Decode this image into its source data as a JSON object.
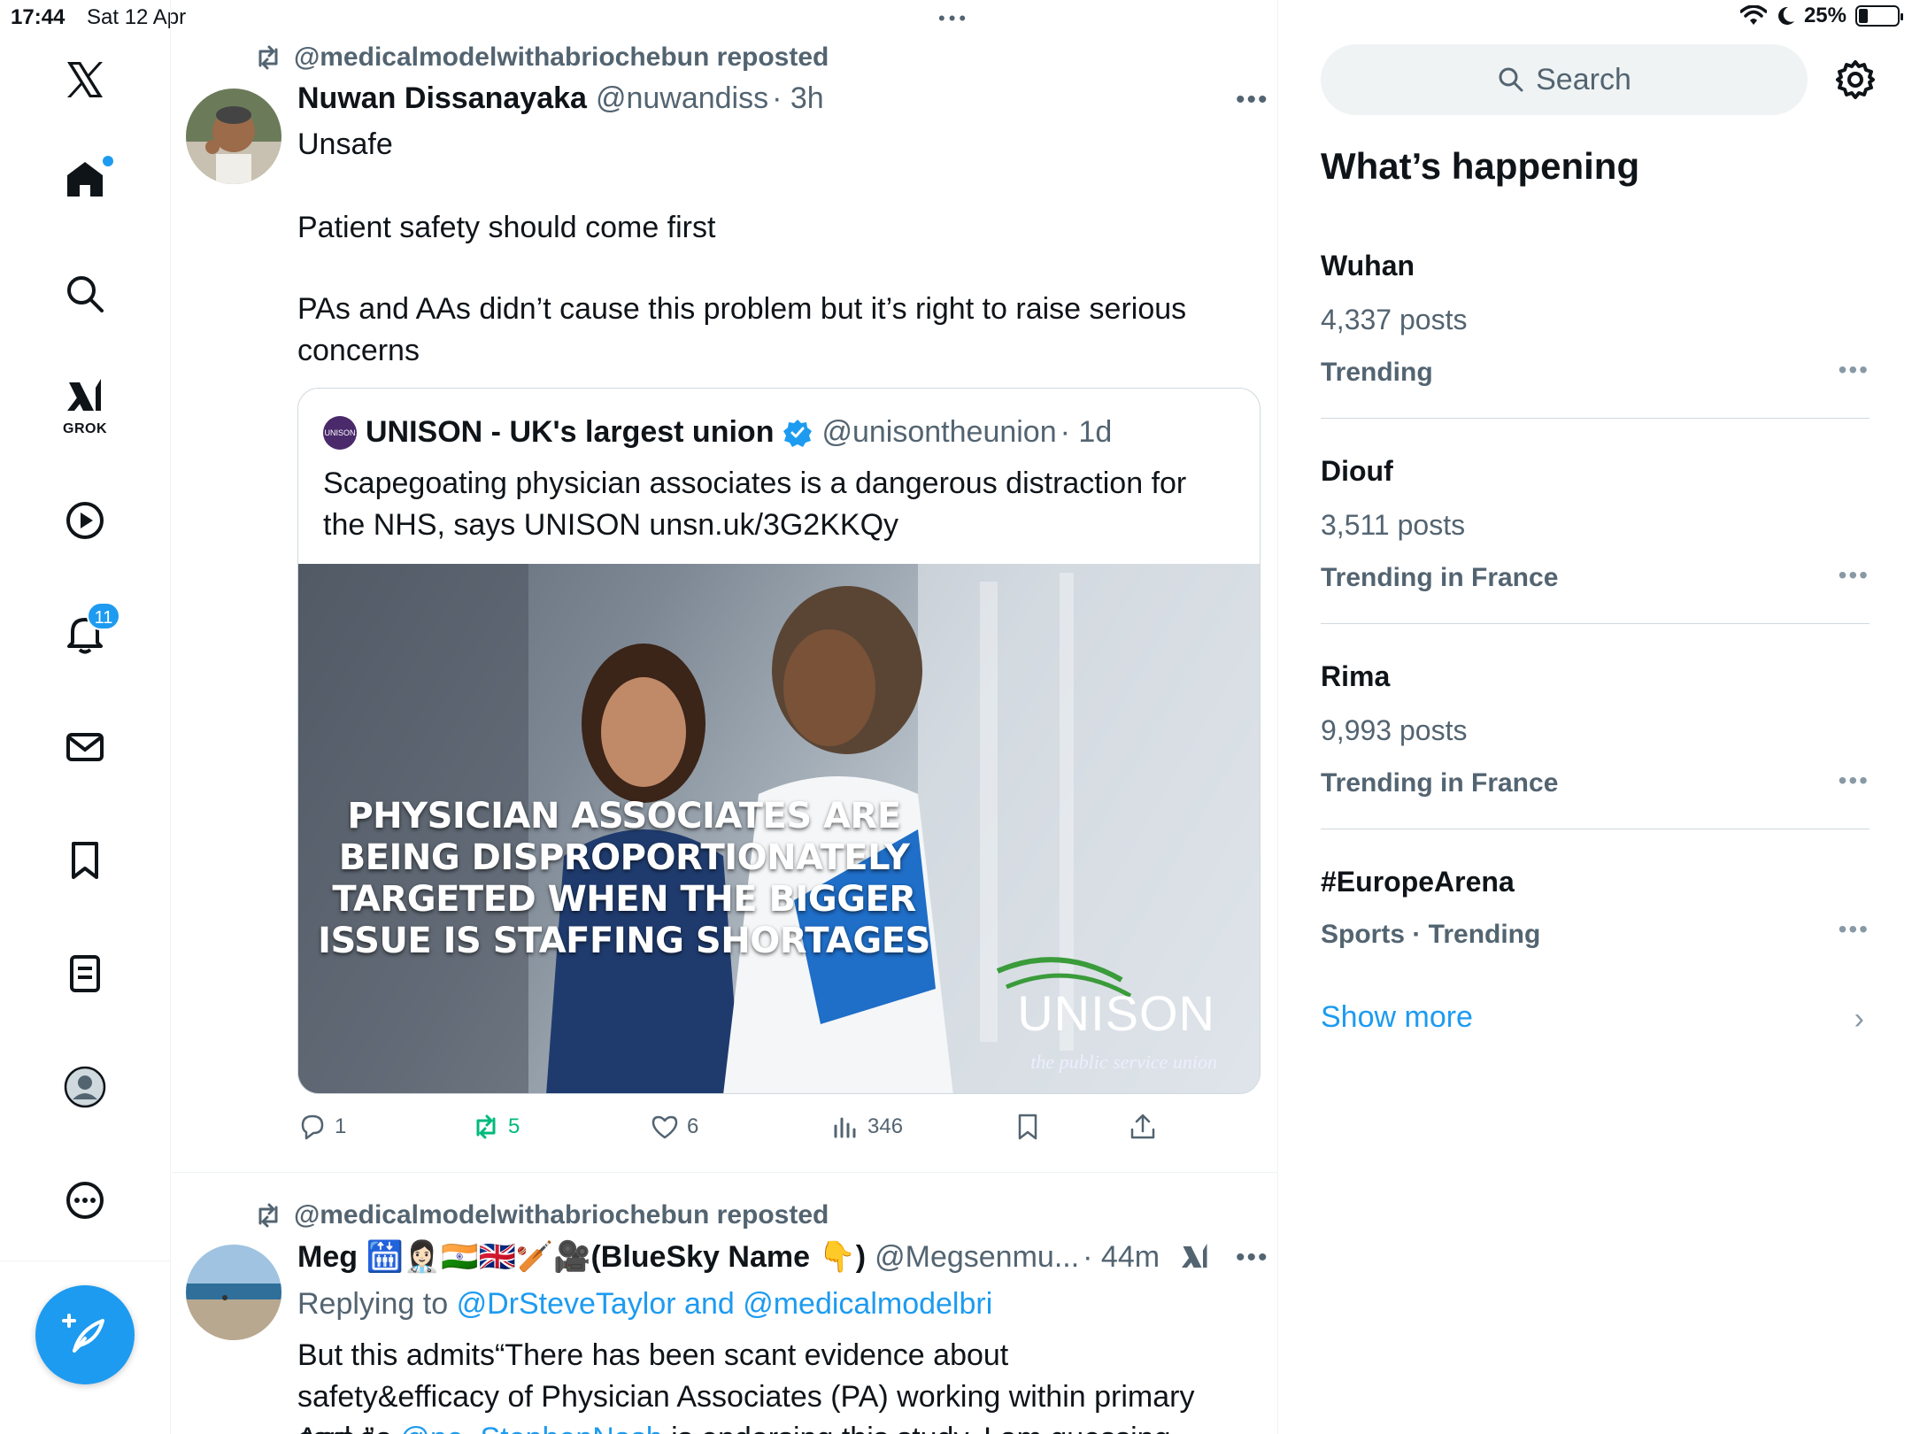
{
  "status_bar": {
    "time": "17:44",
    "date": "Sat 12 Apr",
    "battery": "25%"
  },
  "nav": {
    "grok_label": "GROK",
    "notifications_count": "11"
  },
  "tweet1": {
    "repost_by": "@medicalmodelwithabriochebun reposted",
    "name": "Nuwan Dissanayaka",
    "handle": "@nuwandiss",
    "time": "· 3h",
    "text1": "Unsafe",
    "text2": "Patient safety should come first",
    "text3": "PAs and AAs didn’t cause this problem but it’s right to raise serious concerns",
    "quote": {
      "name": "UNISON - UK's largest union",
      "handle": "@unisontheunion",
      "time": "· 1d",
      "text": "Scapegoating physician associates is a dangerous distraction for the NHS, says UNISON unsn.uk/3G2KKQy",
      "image_headline": "PHYSICIAN ASSOCIATES ARE BEING DISPROPORTIONATELY TARGETED WHEN THE BIGGER ISSUE IS STAFFING SHORTAGES",
      "logo_text": "UNISON",
      "logo_tagline": "the public service union",
      "avatar_text": "UNISON"
    },
    "actions": {
      "replies": "1",
      "reposts": "5",
      "likes": "6",
      "views": "346"
    }
  },
  "tweet2": {
    "repost_by": "@medicalmodelwithabriochebun reposted",
    "name": "Meg 🛗👩🏻‍⚕️🇮🇳🇬🇧🏏🎥(BlueSky Name 👇)",
    "handle": "@Megsenmu...",
    "time": "· 44m",
    "replying_prefix": "Replying to",
    "replying_to": "@DrSteveTaylor and @medicalmodelbri",
    "text1": "But this admits“There has been scant evidence about safety&efficacy of Physician Associates (PA) working within primary care.”",
    "text2_prefix": "And as",
    "text2_link": "@ne_StephenNash",
    "text2_rest": "is endorsing this study, I am guessing he"
  },
  "sidebar": {
    "search_placeholder": "Search",
    "title": "What’s happening",
    "trends": [
      {
        "name": "Wuhan",
        "posts": "4,337 posts",
        "meta": "Trending"
      },
      {
        "name": "Diouf",
        "posts": "3,511 posts",
        "meta": "Trending in France"
      },
      {
        "name": "Rima",
        "posts": "9,993 posts",
        "meta": "Trending in France"
      },
      {
        "name": "#EuropeArena",
        "meta": "Sports · Trending"
      }
    ],
    "show_more": "Show more"
  },
  "colors": {
    "accent": "#1d9bf0",
    "repost_green": "#00ba7c",
    "muted": "#536471"
  }
}
